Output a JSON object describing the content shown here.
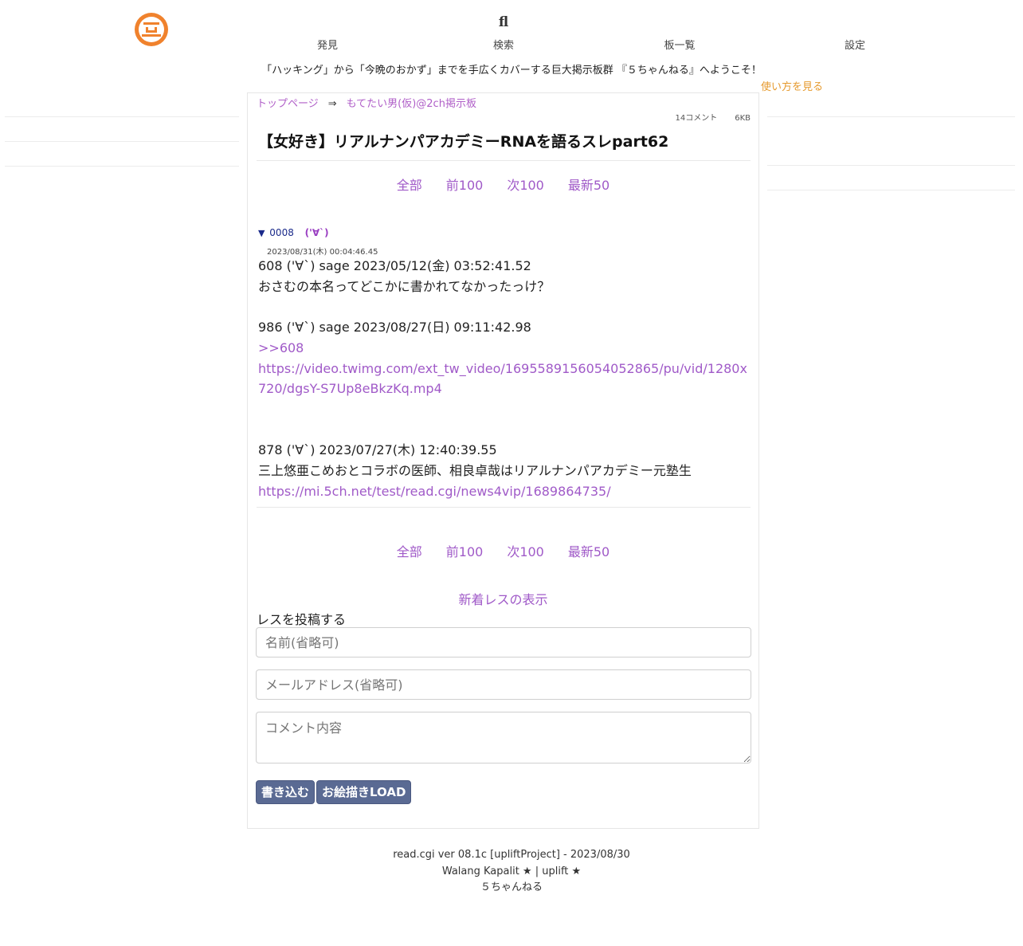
{
  "header": {
    "nav": [
      {
        "icon": "star-icon",
        "glyph": "",
        "label": "発見"
      },
      {
        "icon": "search-icon",
        "glyph": "fl",
        "label": "検索"
      },
      {
        "icon": "board-list-icon",
        "glyph": "",
        "label": "板一覧"
      },
      {
        "icon": "gear-icon",
        "glyph": "",
        "label": "設定"
      }
    ],
    "welcome": "「ハッキング」から「今晩のおかず」までを手広くカバーする巨大掲示板群 『５ちゃんねる』へようこそ！",
    "howto": "使い方を見る"
  },
  "breadcrumb": {
    "top": "トップページ",
    "arrow": "⇒",
    "board": "もてたい男(仮)@2ch掲示板"
  },
  "thread": {
    "comments": "14コメント",
    "size": "6KB",
    "title": "【女好き】リアルナンパアカデミーRNAを語るスレpart62"
  },
  "pager": {
    "all": "全部",
    "prev": "前100",
    "next": "次100",
    "latest": "最新50"
  },
  "post": {
    "triangle": "▼",
    "number": "0008",
    "name": "('∀`)",
    "date": "2023/08/31(木) 00:04:46.45",
    "lines": [
      "608 ('∀`) sage 2023/05/12(金) 03:52:41.52",
      "おさむの本名ってどこかに書かれてなかったっけ？",
      "",
      "986 ('∀`) sage 2023/08/27(日) 09:11:42.98",
      ">>608",
      "https://video.twimg.com/ext_tw_video/1695589156054052865/pu/vid/1280x720/dgsY-S7Up8eBkzKq.mp4",
      "",
      "",
      "878 ('∀`) 2023/07/27(木) 12:40:39.55",
      "三上悠亜こめおとコラボの医師、相良卓哉はリアルナンパアカデミー元塾生",
      "https://mi.5ch.net/test/read.cgi/news4vip/1689864735/"
    ]
  },
  "form": {
    "new_responses": "新着レスの表示",
    "title": "レスを投稿する",
    "name_placeholder": "名前(省略可)",
    "mail_placeholder": "メールアドレス(省略可)",
    "comment_placeholder": "コメント内容",
    "submit": "書き込む",
    "oekaki": "お絵描きLOAD"
  },
  "footer": {
    "version": "read.cgi ver 08.1c [upliftProject] - 2023/08/30",
    "credit": "Walang Kapalit ★ | uplift ★",
    "site": "５ちゃんねる"
  },
  "colors": {
    "link": "#a05ac8",
    "accent": "#f0822d",
    "button": "#5a6a93",
    "howto": "#e69a2e"
  }
}
